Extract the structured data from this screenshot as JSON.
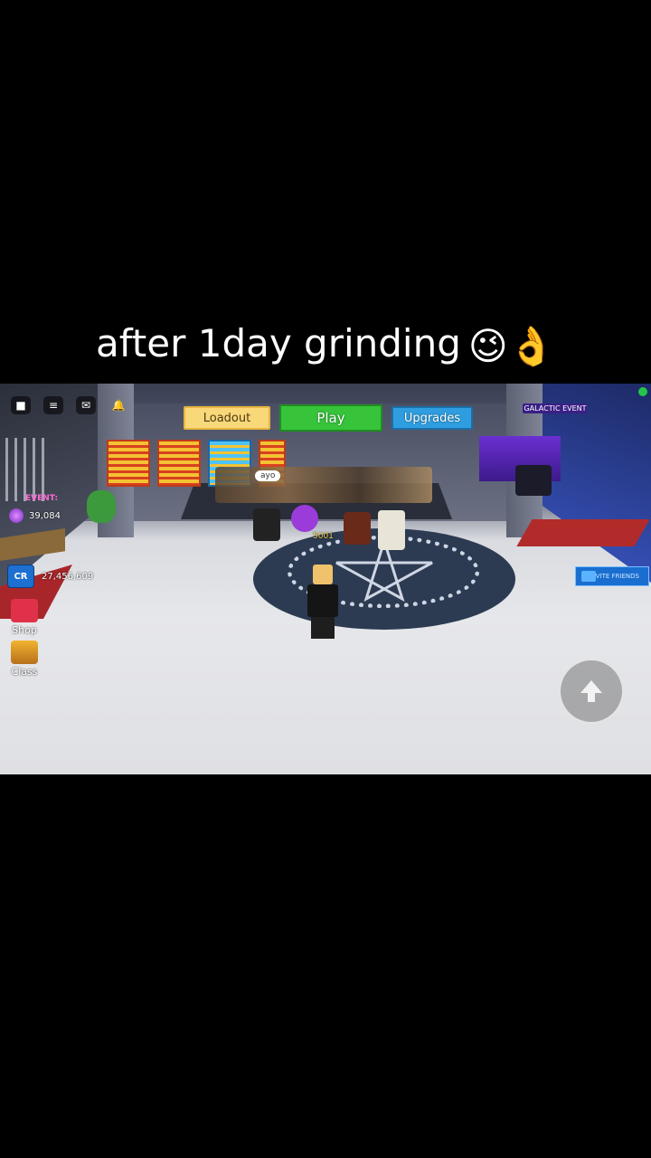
{
  "caption": {
    "text": "after 1day grinding",
    "emoji": "😉👌"
  },
  "hud": {
    "top_buttons": {
      "loadout": "Loadout",
      "play": "Play",
      "upgrades": "Upgrades"
    },
    "galactic_event": "GALACTIC EVENT",
    "event_label": "EVENT:",
    "event_value": "39,084",
    "currency_badge": "CR",
    "currency_value": "27,456,609",
    "shop_label": "Shop",
    "class_label": "Class",
    "invite_label": "INVITE FRIENDS"
  },
  "world": {
    "chat_bubble": "ayo",
    "floating_number": "5001"
  }
}
